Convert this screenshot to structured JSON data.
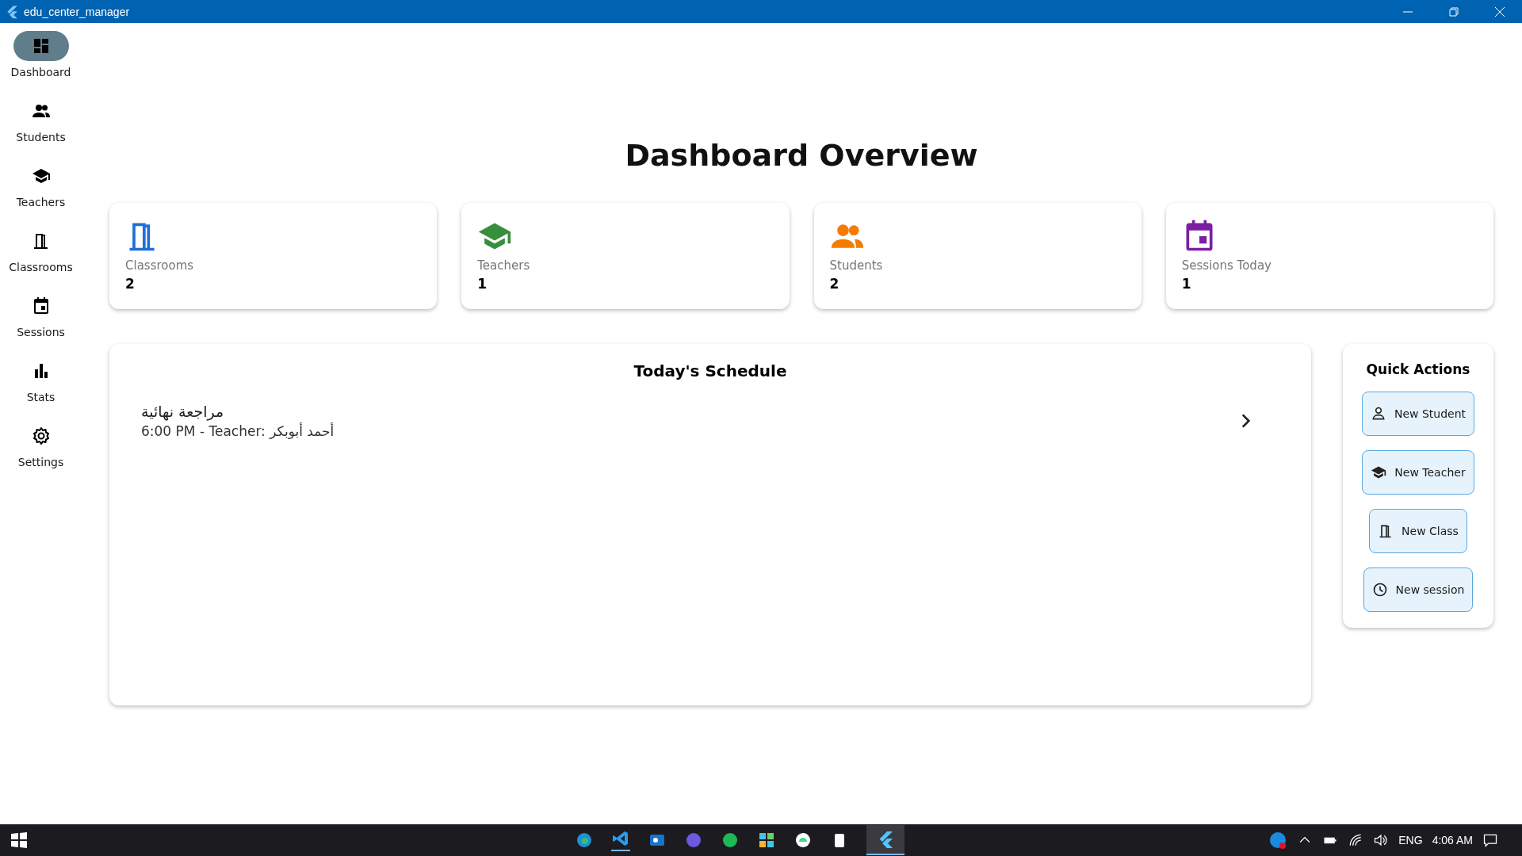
{
  "window": {
    "title": "edu_center_manager"
  },
  "sidebar": {
    "items": [
      {
        "label": "Dashboard",
        "kind": "dashboard",
        "selected": true
      },
      {
        "label": "Students",
        "kind": "people",
        "selected": false
      },
      {
        "label": "Teachers",
        "kind": "school",
        "selected": false
      },
      {
        "label": "Classrooms",
        "kind": "door",
        "selected": false
      },
      {
        "label": "Sessions",
        "kind": "calendar",
        "selected": false
      },
      {
        "label": "Stats",
        "kind": "bars",
        "selected": false
      },
      {
        "label": "Settings",
        "kind": "gear",
        "selected": false
      }
    ]
  },
  "heading": "Dashboard Overview",
  "stat_cards": [
    {
      "label": "Classrooms",
      "value": "2",
      "kind": "door",
      "color": "#1e6fd9"
    },
    {
      "label": "Teachers",
      "value": "1",
      "kind": "school",
      "color": "#388e3c"
    },
    {
      "label": "Students",
      "value": "2",
      "kind": "people",
      "color": "#f57c00"
    },
    {
      "label": "Sessions Today",
      "value": "1",
      "kind": "calendar",
      "color": "#7b1fa2"
    }
  ],
  "schedule": {
    "title": "Today's Schedule",
    "items": [
      {
        "title": "مراجعة نهائية",
        "subtitle": "6:00 PM - Teacher: أحمد أبوبكر"
      }
    ]
  },
  "quick_actions": {
    "title": "Quick Actions",
    "buttons": [
      {
        "label": "New Student",
        "kind": "person"
      },
      {
        "label": "New Teacher",
        "kind": "school"
      },
      {
        "label": "New Class",
        "kind": "door"
      },
      {
        "label": "New session",
        "kind": "clock"
      }
    ]
  },
  "taskbar": {
    "language": "ENG",
    "time": "4:06 AM"
  }
}
